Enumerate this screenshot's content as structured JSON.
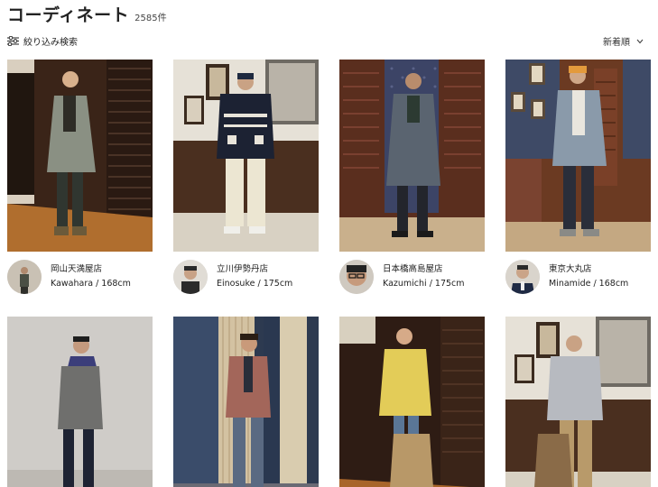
{
  "header": {
    "title": "コーディネート",
    "count": "2585件"
  },
  "filter": {
    "label": "絞り込み検索",
    "icon": "sliders-icon"
  },
  "sort": {
    "label": "新着順",
    "icon": "chevron-down-icon"
  },
  "cards": [
    {
      "store": "岡山天満屋店",
      "staff": "Kawahara / 168cm"
    },
    {
      "store": "立川伊勢丹店",
      "staff": "Einosuke / 175cm"
    },
    {
      "store": "日本橋高島屋店",
      "staff": "Kazumichi / 175cm"
    },
    {
      "store": "東京大丸店",
      "staff": "Minamide / 168cm"
    }
  ]
}
